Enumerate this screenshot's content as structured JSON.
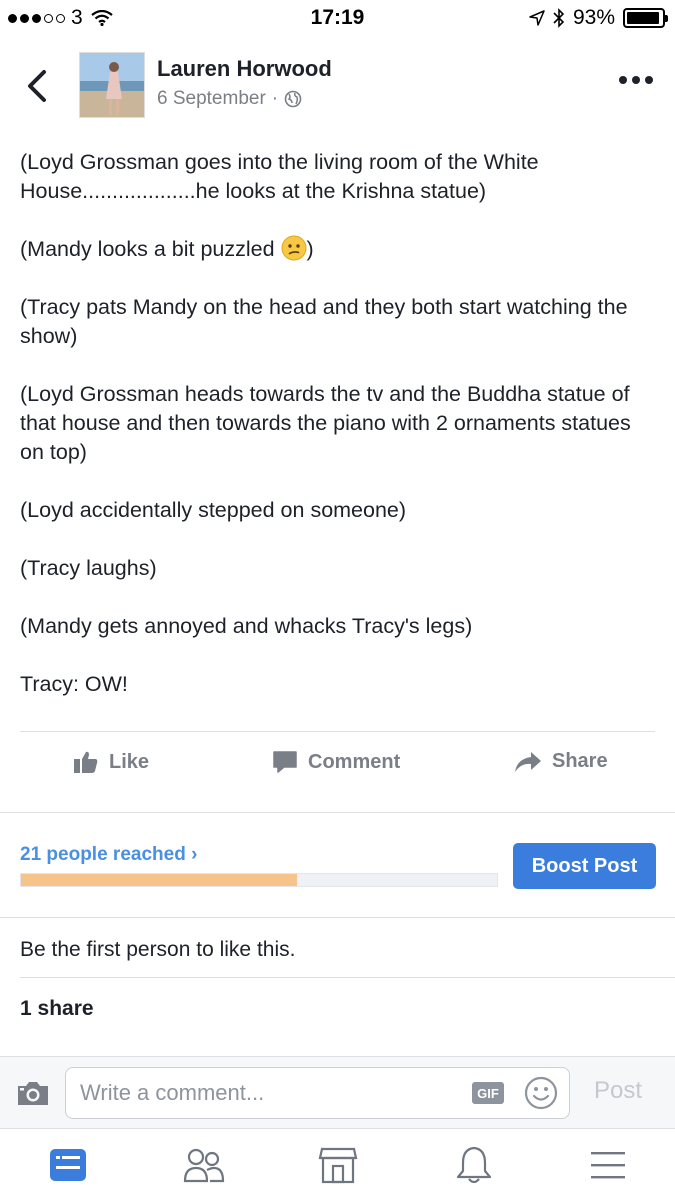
{
  "status_bar": {
    "carrier": "3",
    "time": "17:19",
    "battery": "93%",
    "battery_level": 0.93
  },
  "post": {
    "author": "Lauren Horwood",
    "date": "6 September",
    "separator": "·",
    "paragraphs": [
      "(Loyd Grossman goes into the living room of the White House...................he looks at the Krishna statue)",
      "(Mandy looks a bit puzzled ",
      "(Tracy pats Mandy on the head and they both start watching the show)",
      "(Loyd Grossman heads towards the tv and the Buddha statue of that house and then towards the piano with 2 ornaments statues on top)",
      "(Loyd accidentally stepped on someone)",
      "(Tracy laughs)",
      "(Mandy gets annoyed and whacks Tracy's legs)",
      "Tracy: OW!"
    ],
    "emoji_tail": ")"
  },
  "actions": {
    "like": "Like",
    "comment": "Comment",
    "share": "Share"
  },
  "reach": {
    "label": "21 people reached",
    "chevron": "›",
    "progress": 0.58,
    "boost_label": "Boost Post"
  },
  "engagement": {
    "likes": "Be the first person to like this.",
    "shares": "1 share"
  },
  "comment_bar": {
    "placeholder": "Write a comment...",
    "gif": "GIF",
    "post_label": "Post"
  },
  "colors": {
    "accent": "#3b7ddd",
    "link": "#4a90e2",
    "reach_fill": "#f6c38a",
    "muted": "#7a7f87"
  }
}
